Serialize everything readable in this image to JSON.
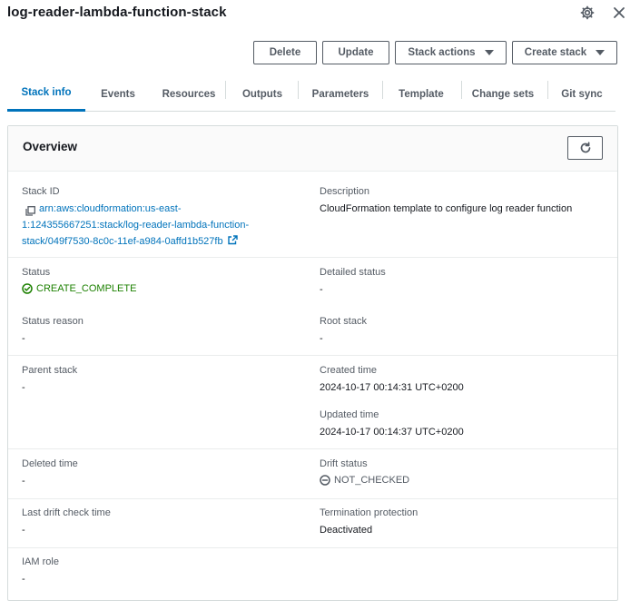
{
  "header": {
    "title": "log-reader-lambda-function-stack",
    "settings_icon": "gear-icon",
    "close_icon": "close-icon"
  },
  "toolbar": {
    "delete": "Delete",
    "update": "Update",
    "stack_actions": "Stack actions",
    "create_stack": "Create stack"
  },
  "tabs": [
    "Stack info",
    "Events",
    "Resources",
    "Outputs",
    "Parameters",
    "Template",
    "Change sets",
    "Git sync"
  ],
  "overview": {
    "title": "Overview",
    "stack_id_label": "Stack ID",
    "stack_id_line1": "arn:aws:cloudformation:us-east-",
    "stack_id_line2": "1:124355667251:stack/log-reader-lambda-function-",
    "stack_id_line3": "stack/049f7530-8c0c-11ef-a984-0affd1b527fb",
    "description_label": "Description",
    "description_value": "CloudFormation template to configure log reader function",
    "status_label": "Status",
    "status_value": "CREATE_COMPLETE",
    "detailed_status_label": "Detailed status",
    "detailed_status_value": "-",
    "status_reason_label": "Status reason",
    "status_reason_value": "-",
    "root_stack_label": "Root stack",
    "root_stack_value": "-",
    "parent_stack_label": "Parent stack",
    "parent_stack_value": "-",
    "created_time_label": "Created time",
    "created_time_value": "2024-10-17 00:14:31 UTC+0200",
    "updated_time_label": "Updated time",
    "updated_time_value": "2024-10-17 00:14:37 UTC+0200",
    "deleted_time_label": "Deleted time",
    "deleted_time_value": "-",
    "drift_status_label": "Drift status",
    "drift_status_value": "NOT_CHECKED",
    "last_drift_label": "Last drift check time",
    "last_drift_value": "-",
    "termination_label": "Termination protection",
    "termination_value": "Deactivated",
    "iam_role_label": "IAM role",
    "iam_role_value": "-"
  },
  "colors": {
    "link": "#0073bb",
    "success": "#1d8102",
    "border": "#d5dbdb"
  }
}
